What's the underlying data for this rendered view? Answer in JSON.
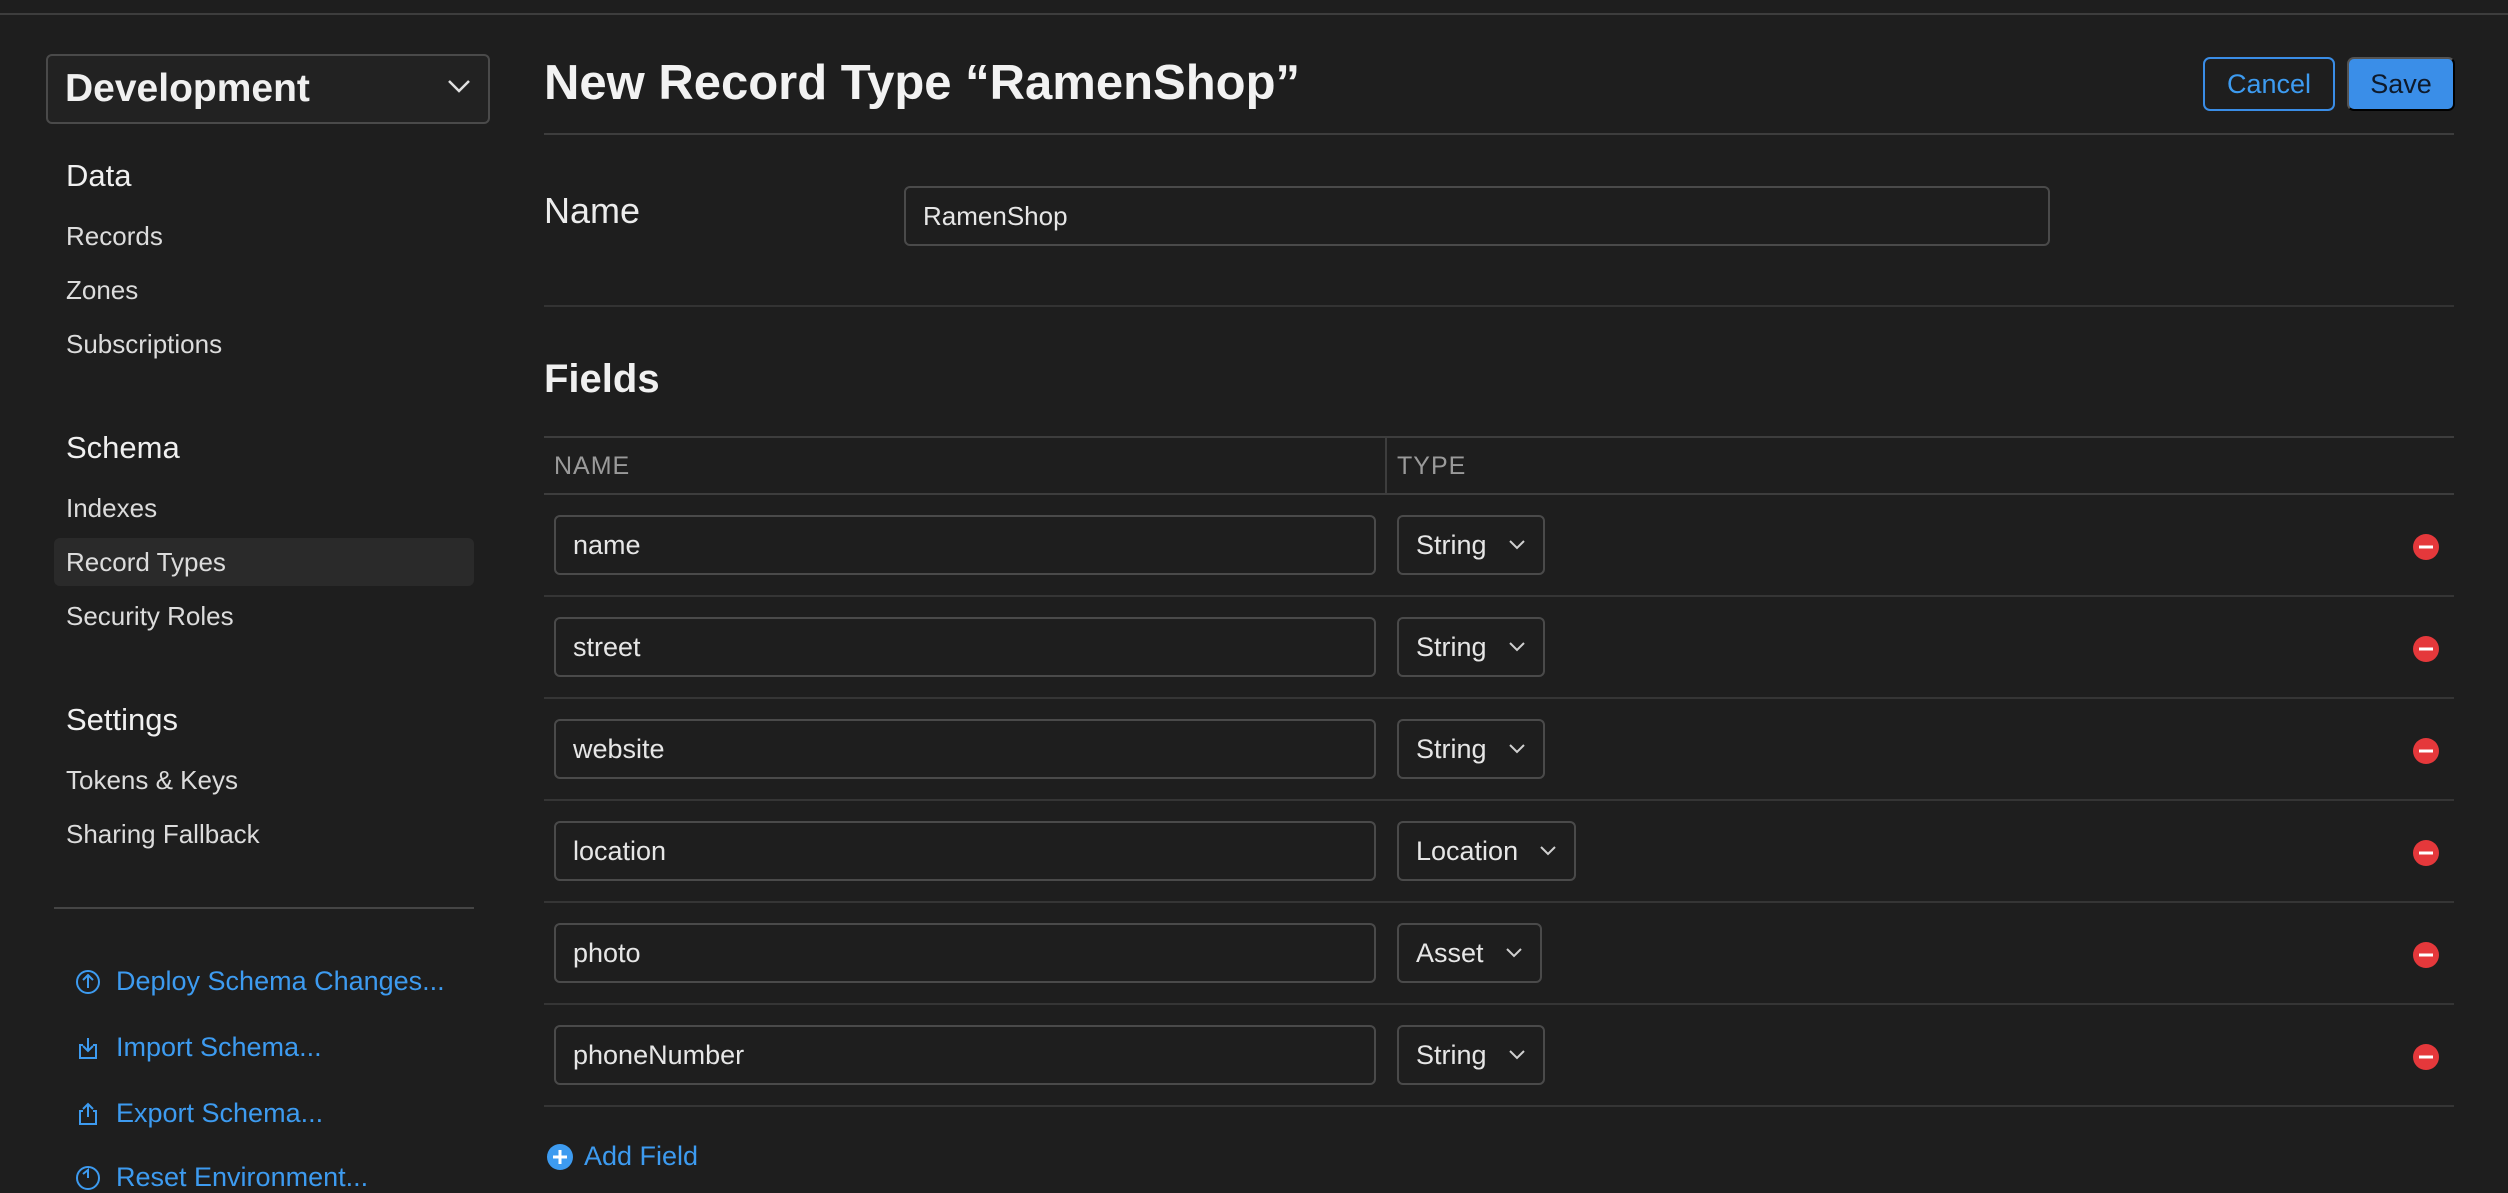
{
  "sidebar": {
    "environment": "Development",
    "sections": [
      {
        "heading": "Data",
        "items": [
          "Records",
          "Zones",
          "Subscriptions"
        ]
      },
      {
        "heading": "Schema",
        "items": [
          "Indexes",
          "Record Types",
          "Security Roles"
        ]
      },
      {
        "heading": "Settings",
        "items": [
          "Tokens & Keys",
          "Sharing Fallback"
        ]
      }
    ],
    "selected_item": "Record Types",
    "actions": [
      {
        "label": "Deploy Schema Changes...",
        "icon": "deploy-icon"
      },
      {
        "label": "Import Schema...",
        "icon": "import-icon"
      },
      {
        "label": "Export Schema...",
        "icon": "export-icon"
      },
      {
        "label": "Reset Environment...",
        "icon": "reset-icon"
      }
    ]
  },
  "header": {
    "title": "New Record Type “RamenShop”",
    "cancel_label": "Cancel",
    "save_label": "Save"
  },
  "name_section": {
    "label": "Name",
    "value": "RamenShop"
  },
  "fields_section": {
    "title": "Fields",
    "columns": [
      "NAME",
      "TYPE"
    ],
    "rows": [
      {
        "name": "name",
        "type": "String"
      },
      {
        "name": "street",
        "type": "String"
      },
      {
        "name": "website",
        "type": "String"
      },
      {
        "name": "location",
        "type": "Location"
      },
      {
        "name": "photo",
        "type": "Asset"
      },
      {
        "name": "phoneNumber",
        "type": "String"
      }
    ],
    "add_label": "Add Field"
  },
  "colors": {
    "background": "#1e1e1e",
    "accent": "#3d9bf0",
    "remove": "#e5383b"
  }
}
